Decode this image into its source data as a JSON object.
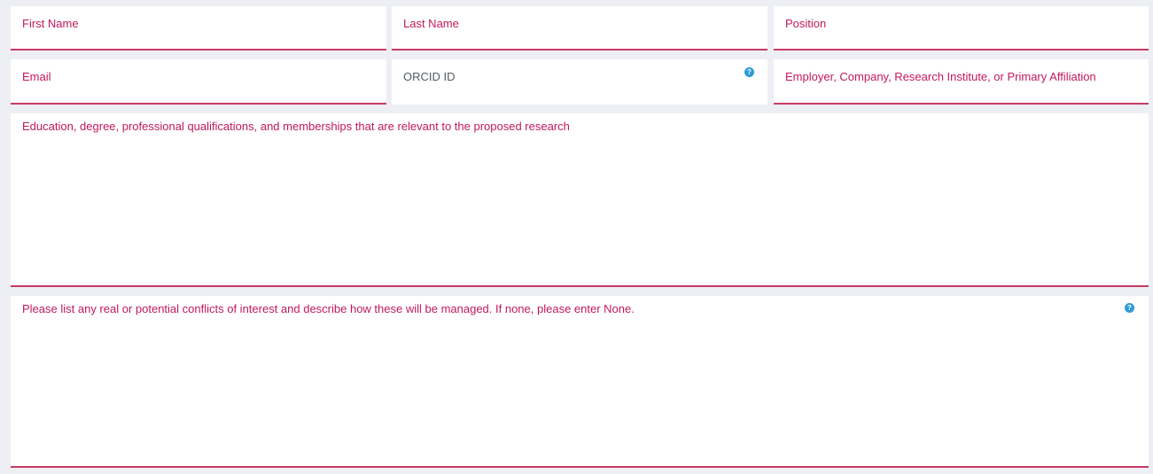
{
  "form": {
    "row1": {
      "first_name_label": "First Name",
      "last_name_label": "Last Name",
      "position_label": "Position"
    },
    "row2": {
      "email_label": "Email",
      "orcid_label": "ORCID ID",
      "employer_label": "Employer, Company, Research Institute, or Primary Affiliation"
    },
    "education_label": "Education, degree, professional qualifications, and memberships that are relevant to the proposed research",
    "conflicts_label": "Please list any real or potential conflicts of interest and describe how these will be managed. If none, please enter None.",
    "help_icon_glyph": "?"
  },
  "icons": {
    "help": "help-circle-icon"
  },
  "colors": {
    "accent": "#c53b62",
    "label": "#c2185b",
    "neutral_label": "#555b63",
    "help_icon": "#2e9bd6",
    "background": "#eeeff4",
    "field_background": "#ffffff"
  }
}
